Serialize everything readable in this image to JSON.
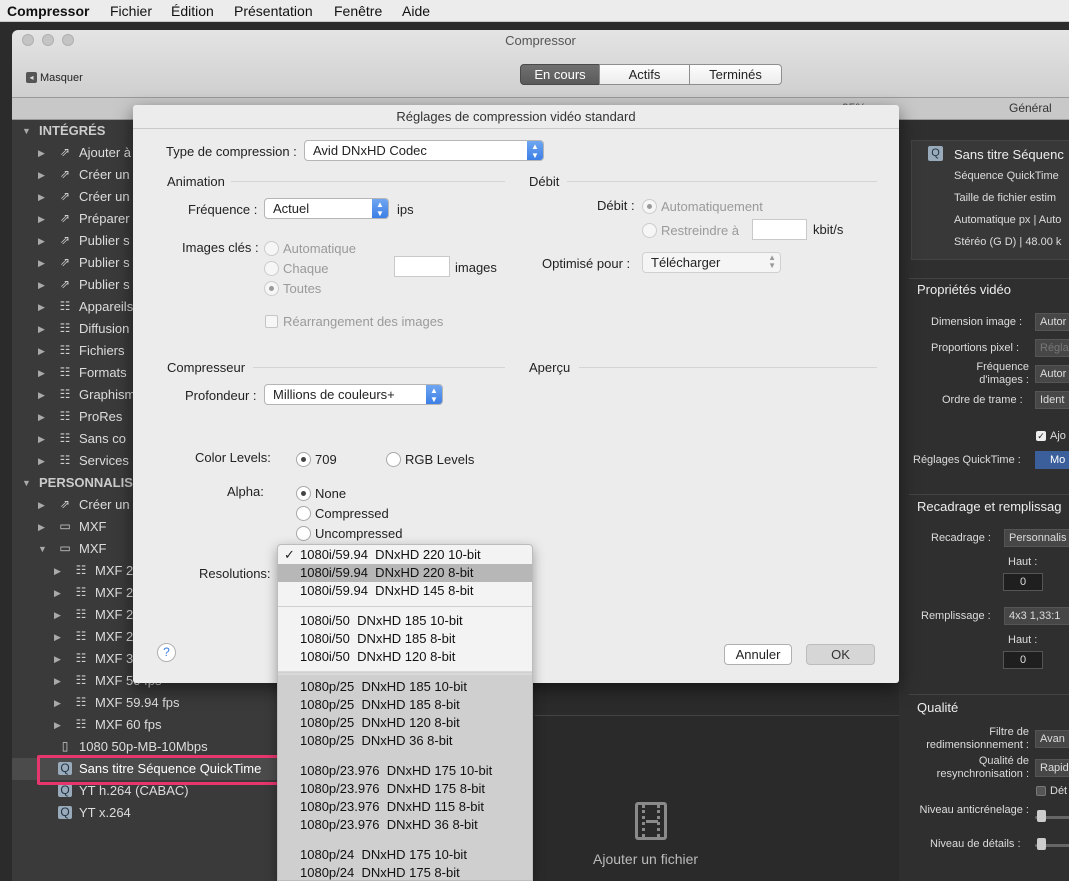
{
  "menubar": {
    "app": "Compressor",
    "items": [
      "Fichier",
      "Édition",
      "Présentation",
      "Fenêtre",
      "Aide"
    ]
  },
  "window": {
    "title": "Compressor",
    "hide_label": "Masquer",
    "segments": [
      "En cours",
      "Actifs",
      "Terminés"
    ],
    "strip_general": "Général",
    "strip_partial": "95%"
  },
  "sidebar": {
    "section_builtin": "INTÉGRÉS",
    "builtin_items": [
      "Ajouter à",
      "Créer un",
      "Créer un",
      "Préparer",
      "Publier s",
      "Publier s",
      "Publier s",
      "Appareils",
      "Diffusion",
      "Fichiers",
      "Formats",
      "Graphism",
      "ProRes",
      "Sans co",
      "Services"
    ],
    "section_custom": "PERSONNALIS",
    "custom_items": [
      "Créer un",
      "MXF",
      "MXF"
    ],
    "mxf_children": [
      "MXF 2",
      "MXF 2",
      "MXF 2",
      "MXF 2",
      "MXF 3",
      "MXF 50 fps",
      "MXF 59.94 fps",
      "MXF 60 fps"
    ],
    "bottom_items": [
      "1080 50p-MB-10Mbps",
      "Sans titre Séquence QuickTime",
      "YT h.264 (CABAC)",
      "YT x.264"
    ]
  },
  "right_panel": {
    "job_title": "Sans titre Séquenc",
    "job_lines": [
      "Séquence QuickTime",
      "Taille de fichier estim",
      "Automatique px | Auto",
      "Stéréo (G D) | 48.00 k"
    ],
    "video_props_title": "Propriétés vidéo",
    "video_rows": [
      {
        "label": "Dimension image :",
        "value": "Autor"
      },
      {
        "label": "Proportions pixel :",
        "value": "Régla"
      },
      {
        "label": "Fréquence d'images :",
        "value": "Autor"
      },
      {
        "label": "Ordre de trame :",
        "value": "Ident"
      }
    ],
    "ajouter_partial": "Ajo",
    "quicktime_label": "Réglages QuickTime :",
    "quicktime_btn": "Mo",
    "crop_title": "Recadrage et remplissag",
    "crop_label": "Recadrage :",
    "crop_value": "Personnalis",
    "haut": "Haut :",
    "zero": "0",
    "fill_label": "Remplissage :",
    "fill_value": "4x3 1,33:1",
    "quality_title": "Qualité",
    "quality_rows": [
      {
        "label": "Filtre de redimensionnement :",
        "value": "Avan"
      },
      {
        "label": "Qualité de resynchronisation :",
        "value": "Rapid"
      },
      {
        "label": "Niveau anticrénelage :",
        "value": ""
      },
      {
        "label": "Niveau de détails :",
        "value": ""
      }
    ],
    "det_partial": "Dét"
  },
  "bottom": {
    "add_file": "Ajouter un fichier"
  },
  "dialog": {
    "title": "Réglages de compression vidéo standard",
    "compression_type_label": "Type de compression :",
    "compression_type_value": "Avid DNxHD Codec",
    "animation_title": "Animation",
    "frequency_label": "Fréquence :",
    "frequency_value": "Actuel",
    "ips": "ips",
    "keyframes_label": "Images clés :",
    "kf_auto": "Automatique",
    "kf_every": "Chaque",
    "kf_images": "images",
    "kf_all": "Toutes",
    "reorder": "Réarrangement des images",
    "rate_title": "Débit",
    "rate_label": "Débit :",
    "rate_auto": "Automatiquement",
    "rate_limit": "Restreindre à",
    "rate_unit": "kbit/s",
    "optimize_label": "Optimisé pour :",
    "optimize_value": "Télécharger",
    "compressor_title": "Compresseur",
    "depth_label": "Profondeur :",
    "depth_value": "Millions de couleurs+",
    "preview_title": "Aperçu",
    "color_levels_label": "Color Levels:",
    "cl_709": "709",
    "cl_rgb": "RGB Levels",
    "alpha_label": "Alpha:",
    "alpha_none": "None",
    "alpha_compressed": "Compressed",
    "alpha_uncompressed": "Uncompressed",
    "resolutions_label": "Resolutions:",
    "help": "?",
    "cancel": "Annuler",
    "ok": "OK"
  },
  "resolutions_menu": {
    "checkmark": "✓",
    "groups": [
      [
        "1080i/59.94  DNxHD 220 10-bit",
        "1080i/59.94  DNxHD 220 8-bit",
        "1080i/59.94  DNxHD 145 8-bit"
      ],
      [
        "1080i/50  DNxHD 185 10-bit",
        "1080i/50  DNxHD 185 8-bit",
        "1080i/50  DNxHD 120 8-bit"
      ],
      [
        "1080p/25  DNxHD 185 10-bit",
        "1080p/25  DNxHD 185 8-bit",
        "1080p/25  DNxHD 120 8-bit",
        "1080p/25  DNxHD 36 8-bit"
      ],
      [
        "1080p/23.976  DNxHD 175 10-bit",
        "1080p/23.976  DNxHD 175 8-bit",
        "1080p/23.976  DNxHD 115 8-bit",
        "1080p/23.976  DNxHD 36 8-bit"
      ],
      [
        "1080p/24  DNxHD 175 10-bit",
        "1080p/24  DNxHD 175 8-bit"
      ]
    ]
  },
  "colors": {
    "highlight": "#e7366e",
    "accent": "#3c7fe6"
  }
}
